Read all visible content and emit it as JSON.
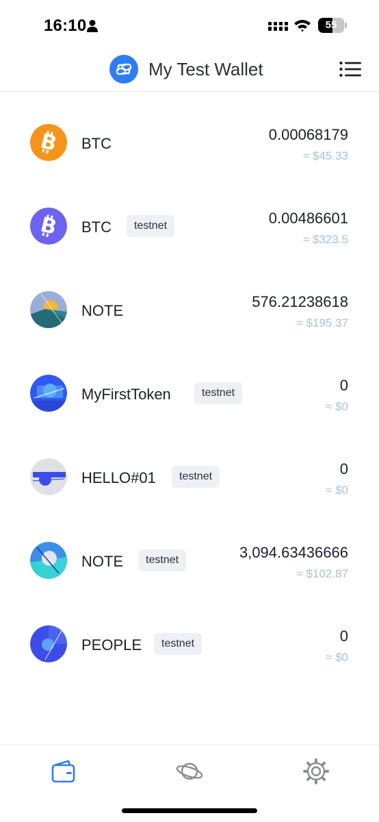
{
  "status_bar": {
    "time": "16:10",
    "battery": "55",
    "battery_level": 0.55
  },
  "header": {
    "title": "My Test Wallet"
  },
  "assets": [
    {
      "name": "BTC",
      "tag": "",
      "amount": "0.00068179",
      "fiat": "≈ $45.33",
      "icon": "bitcoin-icon",
      "color": "#f7931a"
    },
    {
      "name": "BTC",
      "tag": "testnet",
      "amount": "0.00486601",
      "fiat": "≈ $323.5",
      "icon": "bitcoin-testnet-icon",
      "color": "#6c63f0"
    },
    {
      "name": "NOTE",
      "tag": "",
      "amount": "576.21238618",
      "fiat": "≈ $195.37",
      "icon": "note-token-icon",
      "color": "#2e6e78"
    },
    {
      "name": "MyFirstToken",
      "tag": "testnet",
      "amount": "0",
      "fiat": "≈ $0",
      "icon": "myfirsttoken-icon",
      "color": "#2f59f0"
    },
    {
      "name": "HELLO#01",
      "tag": "testnet",
      "amount": "0",
      "fiat": "≈ $0",
      "icon": "hello-token-icon",
      "color": "#3b4de8"
    },
    {
      "name": "NOTE",
      "tag": "testnet",
      "amount": "3,094.63436666",
      "fiat": "≈ $102.87",
      "icon": "note-testnet-icon",
      "color": "#38c9d9"
    },
    {
      "name": "PEOPLE",
      "tag": "testnet",
      "amount": "0",
      "fiat": "≈ $0",
      "icon": "people-token-icon",
      "color": "#3b4de8"
    }
  ],
  "tabs": [
    {
      "icon": "wallet-icon",
      "active": true
    },
    {
      "icon": "planet-icon",
      "active": false
    },
    {
      "icon": "settings-gear-icon",
      "active": false
    }
  ],
  "colors": {
    "accent": "#2f7cf6",
    "fiat_text": "#a9c0dc",
    "tag_bg": "#eef0f5",
    "inactive_icon": "#8a8d94"
  }
}
